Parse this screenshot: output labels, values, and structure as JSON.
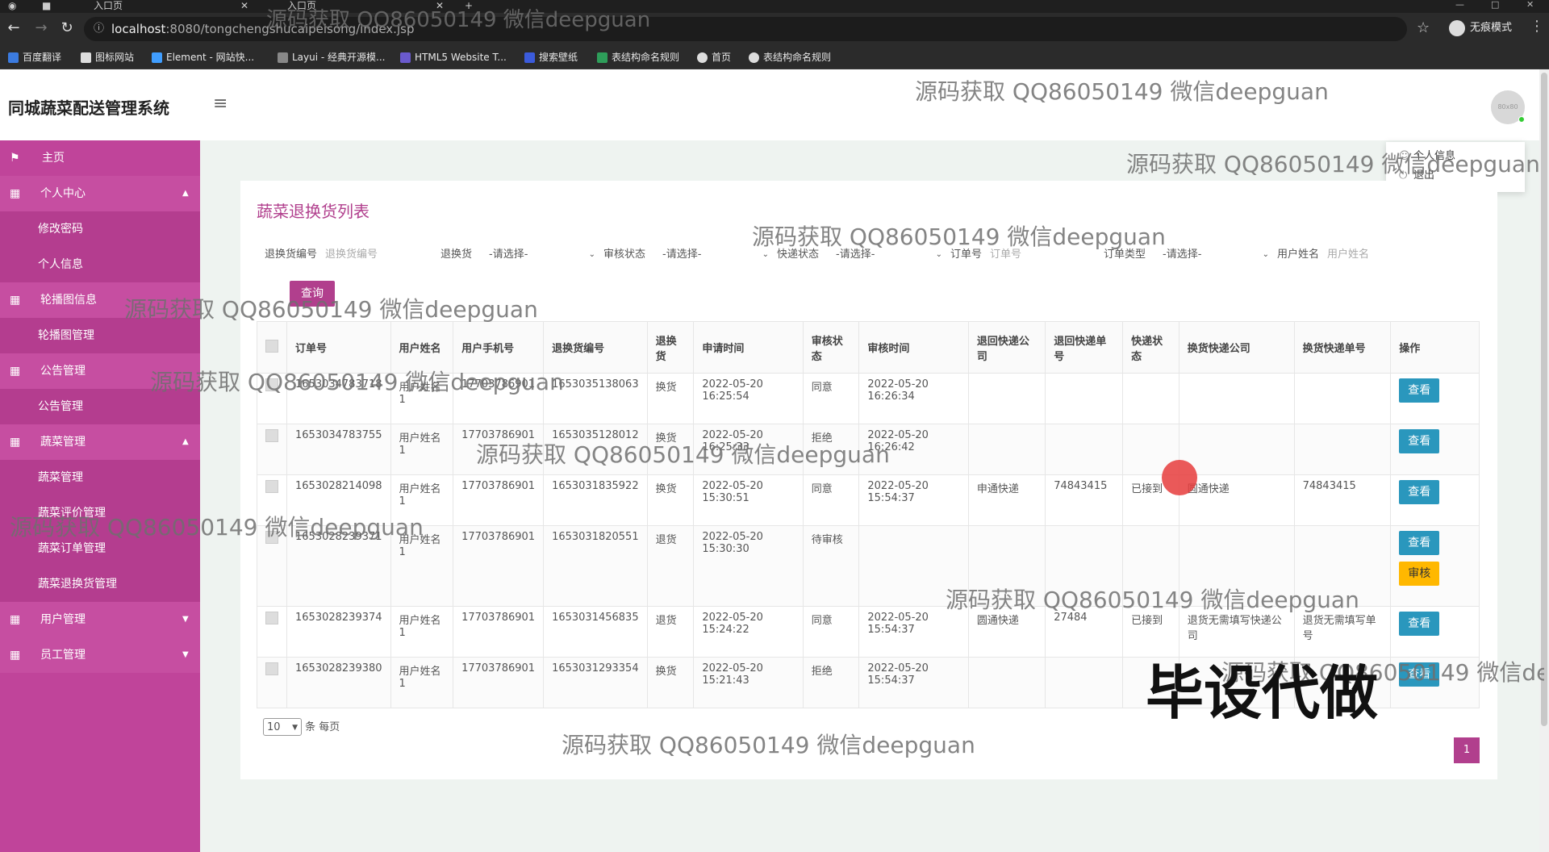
{
  "browser": {
    "tabs": [
      {
        "label": "",
        "active": false
      },
      {
        "label": "入口页",
        "active": true
      },
      {
        "label": "入口页",
        "active": false
      }
    ],
    "new_tab": "+",
    "url_host": "localhost",
    "url_path": ":8080/tongchengshucaipeisong/index.jsp",
    "incognito_label": "无痕模式",
    "bookmarks": [
      "百度翻译",
      "图标网站",
      "Element - 网站快...",
      "Layui - 经典开源模...",
      "HTML5 Website T...",
      "搜索壁纸",
      "表结构命名规则",
      "首页",
      "表结构命名规则"
    ]
  },
  "app": {
    "title": "同城蔬菜配送管理系统",
    "avatar_text": "80x80",
    "user_menu": [
      "个人信息",
      "退出"
    ]
  },
  "sidebar": {
    "items": [
      {
        "label": "主页",
        "icon": "flag-icon",
        "type": "home"
      },
      {
        "label": "个人中心",
        "icon": "grid-icon",
        "type": "parent",
        "caret": "▲"
      },
      {
        "label": "修改密码",
        "type": "sub"
      },
      {
        "label": "个人信息",
        "type": "sub"
      },
      {
        "label": "轮播图信息",
        "icon": "grid-icon",
        "type": "parent",
        "caret": ""
      },
      {
        "label": "轮播图管理",
        "type": "sub"
      },
      {
        "label": "公告管理",
        "icon": "grid-icon",
        "type": "parent",
        "caret": ""
      },
      {
        "label": "公告管理",
        "type": "sub"
      },
      {
        "label": "蔬菜管理",
        "icon": "grid-icon",
        "type": "parent",
        "caret": "▲"
      },
      {
        "label": "蔬菜管理",
        "type": "sub"
      },
      {
        "label": "蔬菜评价管理",
        "type": "sub"
      },
      {
        "label": "蔬菜订单管理",
        "type": "sub"
      },
      {
        "label": "蔬菜退换货管理",
        "type": "sub"
      },
      {
        "label": "用户管理",
        "icon": "grid-icon",
        "type": "parent",
        "caret": "▼"
      },
      {
        "label": "员工管理",
        "icon": "grid-icon",
        "type": "parent",
        "caret": "▼"
      }
    ]
  },
  "page": {
    "title": "蔬菜退换货列表",
    "filters": {
      "exchange_no_label": "退换货编号",
      "exchange_no_placeholder": "退换货编号",
      "type_label": "退换货",
      "type_value": "-请选择-",
      "audit_label": "审核状态",
      "audit_value": "-请选择-",
      "express_label": "快递状态",
      "express_value": "-请选择-",
      "order_no_label": "订单号",
      "order_no_placeholder": "订单号",
      "order_type_label": "订单类型",
      "order_type_value": "-请选择-",
      "username_label": "用户姓名",
      "username_placeholder": "用户姓名"
    },
    "search_button": "查询",
    "table": {
      "headers": [
        "订单号",
        "用户姓名",
        "用户手机号",
        "退换货编号",
        "退换货",
        "申请时间",
        "审核状态",
        "审核时间",
        "退回快递公司",
        "退回快递单号",
        "快递状态",
        "换货快递公司",
        "换货快递单号",
        "操作"
      ],
      "rows": [
        {
          "order": "1653034783718",
          "name": "用户姓名1",
          "phone": "17703786901",
          "exno": "1653035138063",
          "type": "换货",
          "apply": "2022-05-20 16:25:54",
          "audit": "同意",
          "audit_time": "2022-05-20 16:26:34",
          "ret_co": "",
          "ret_no": "",
          "exp": "",
          "ex_co": "",
          "ex_no": "",
          "audit_btn": false
        },
        {
          "order": "1653034783755",
          "name": "用户姓名1",
          "phone": "17703786901",
          "exno": "1653035128012",
          "type": "换货",
          "apply": "2022-05-20 16:25:33",
          "audit": "拒绝",
          "audit_time": "2022-05-20 16:26:42",
          "ret_co": "",
          "ret_no": "",
          "exp": "",
          "ex_co": "",
          "ex_no": "",
          "audit_btn": false
        },
        {
          "order": "1653028214098",
          "name": "用户姓名1",
          "phone": "17703786901",
          "exno": "1653031835922",
          "type": "换货",
          "apply": "2022-05-20 15:30:51",
          "audit": "同意",
          "audit_time": "2022-05-20 15:54:37",
          "ret_co": "申通快递",
          "ret_no": "74843415",
          "exp": "已接到",
          "ex_co": "圆通快递",
          "ex_no": "74843415",
          "audit_btn": false
        },
        {
          "order": "1653028239371",
          "name": "用户姓名1",
          "phone": "17703786901",
          "exno": "1653031820551",
          "type": "退货",
          "apply": "2022-05-20 15:30:30",
          "audit": "待审核",
          "audit_time": "",
          "ret_co": "",
          "ret_no": "",
          "exp": "",
          "ex_co": "",
          "ex_no": "",
          "audit_btn": true
        },
        {
          "order": "1653028239374",
          "name": "用户姓名1",
          "phone": "17703786901",
          "exno": "1653031456835",
          "type": "退货",
          "apply": "2022-05-20 15:24:22",
          "audit": "同意",
          "audit_time": "2022-05-20 15:54:37",
          "ret_co": "圆通快递",
          "ret_no": "27484",
          "exp": "已接到",
          "ex_co": "退货无需填写快递公司",
          "ex_no": "退货无需填写单号",
          "audit_btn": false
        },
        {
          "order": "1653028239380",
          "name": "用户姓名1",
          "phone": "17703786901",
          "exno": "1653031293354",
          "type": "换货",
          "apply": "2022-05-20 15:21:43",
          "audit": "拒绝",
          "audit_time": "2022-05-20 15:54:37",
          "ret_co": "",
          "ret_no": "",
          "exp": "",
          "ex_co": "",
          "ex_no": "",
          "audit_btn": false
        }
      ],
      "view_label": "查看",
      "audit_label": "审核"
    },
    "page_size": "10",
    "page_size_suffix": "条 每页",
    "current_page": "1"
  },
  "overlays": {
    "watermark": "源码获取 QQ86050149 微信deepguan",
    "banner": "毕设代做"
  },
  "colors": {
    "sidebar": "#c0449a",
    "accent": "#b13f8d",
    "view_button": "#2a97bd",
    "audit_button": "#ffb800"
  }
}
